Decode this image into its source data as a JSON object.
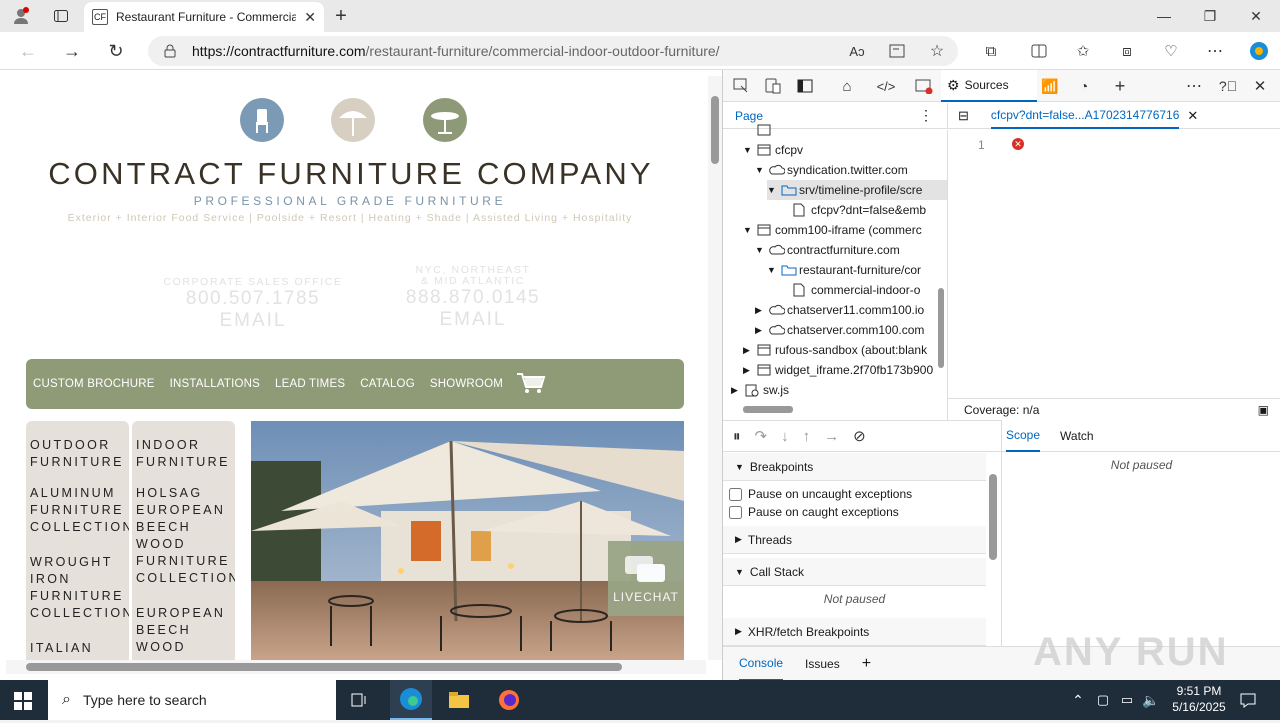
{
  "browser": {
    "tab_title": "Restaurant Furniture - Commercial",
    "url_host": "https://contractfurniture.com",
    "url_path": "/restaurant-furniture/commercial-indoor-outdoor-furniture/"
  },
  "site": {
    "name": "CONTRACT FURNITURE COMPANY",
    "tagline": "PROFESSIONAL GRADE FURNITURE",
    "subline": "Exterior + Interior Food Service | Poolside + Resort | Heating + Shade | Assisted Living + Hospitality",
    "corp_label": "CORPORATE SALES OFFICE",
    "corp_phone": "800.507.1785",
    "corp_email": "EMAIL",
    "nyc_label1": "NYC, NORTHEAST",
    "nyc_label2": "& MID ATLANTIC",
    "nyc_phone": "888.870.0145",
    "nyc_email": "EMAIL",
    "menu": [
      "CUSTOM BROCHURE",
      "INSTALLATIONS",
      "LEAD TIMES",
      "CATALOG",
      "SHOWROOM"
    ],
    "col1": [
      "OUTDOOR\nFURNITURE",
      "ALUMINUM\nFURNITURE\nCOLLECTIONS",
      "WROUGHT\nIRON\nFURNITURE\nCOLLECTIONS",
      "ITALIAN"
    ],
    "col2": [
      "INDOOR\nFURNITURE",
      "HOLSAG\nEUROPEAN\nBEECH\nWOOD\nFURNITURE\nCOLLECTION",
      "EUROPEAN\nBEECH\nWOOD"
    ],
    "livechat": "LIVECHAT"
  },
  "devtools": {
    "sources_tab": "Sources",
    "page_tab": "Page",
    "file_tab": "cfcpv?dnt=false...A1702314776716",
    "tree": [
      {
        "label": "cfcpv",
        "indent": 1,
        "type": "frame",
        "arrow": "down"
      },
      {
        "label": "syndication.twitter.com",
        "indent": 2,
        "type": "cloud",
        "arrow": "down"
      },
      {
        "label": "srv/timeline-profile/scre",
        "indent": 3,
        "type": "folder",
        "arrow": "down"
      },
      {
        "label": "cfcpv?dnt=false&emb",
        "indent": 4,
        "type": "file",
        "arrow": ""
      },
      {
        "label": "comm100-iframe (commerc",
        "indent": 1,
        "type": "frame",
        "arrow": "down"
      },
      {
        "label": "contractfurniture.com",
        "indent": 2,
        "type": "cloud",
        "arrow": "down"
      },
      {
        "label": "restaurant-furniture/cor",
        "indent": 3,
        "type": "folder",
        "arrow": "down"
      },
      {
        "label": "commercial-indoor-o",
        "indent": 4,
        "type": "file",
        "arrow": ""
      },
      {
        "label": "chatserver11.comm100.io",
        "indent": 2,
        "type": "cloud",
        "arrow": "right"
      },
      {
        "label": "chatserver.comm100.com",
        "indent": 2,
        "type": "cloud",
        "arrow": "right"
      },
      {
        "label": "rufous-sandbox (about:blank",
        "indent": 1,
        "type": "frame",
        "arrow": "right"
      },
      {
        "label": "widget_iframe.2f70fb173b900",
        "indent": 1,
        "type": "frame",
        "arrow": "right"
      },
      {
        "label": "sw.js",
        "indent": 0,
        "type": "gear",
        "arrow": "right"
      }
    ],
    "line_number": "1",
    "coverage": "Coverage: n/a",
    "breakpoints": "Breakpoints",
    "pause_uncaught": "Pause on uncaught exceptions",
    "pause_caught": "Pause on caught exceptions",
    "threads": "Threads",
    "call_stack": "Call Stack",
    "not_paused": "Not paused",
    "xhr": "XHR/fetch Breakpoints",
    "scope": "Scope",
    "watch": "Watch",
    "console": "Console",
    "issues": "Issues"
  },
  "taskbar": {
    "search_placeholder": "Type here to search",
    "time": "9:51 PM",
    "date": "5/16/2025"
  },
  "watermark": "ANY RUN",
  "colors": {
    "accent": "#0067c0",
    "menu_green": "#8f9a76",
    "tagline_blue": "#7a93a8",
    "error_red": "#d93025"
  }
}
